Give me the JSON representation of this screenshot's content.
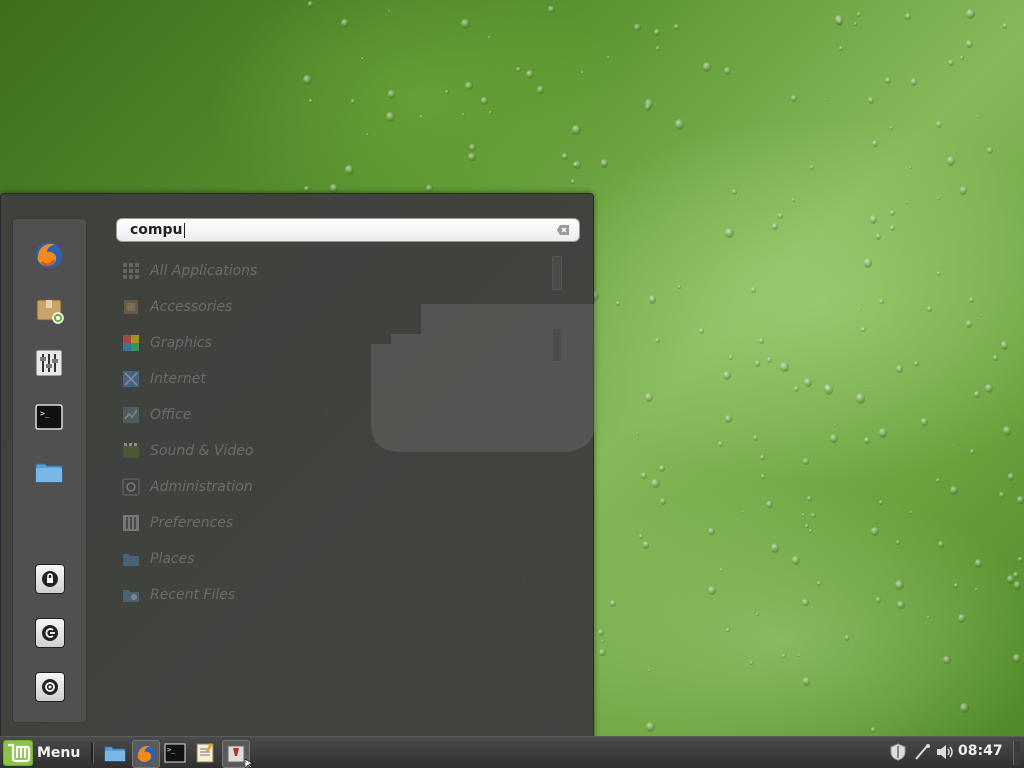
{
  "search": {
    "value": "compu"
  },
  "categories": [
    {
      "label": "All Applications",
      "icon": "all-apps-icon"
    },
    {
      "label": "Accessories",
      "icon": "accessories-icon"
    },
    {
      "label": "Graphics",
      "icon": "graphics-icon"
    },
    {
      "label": "Internet",
      "icon": "internet-icon"
    },
    {
      "label": "Office",
      "icon": "office-icon"
    },
    {
      "label": "Sound & Video",
      "icon": "sound-video-icon"
    },
    {
      "label": "Administration",
      "icon": "administration-icon"
    },
    {
      "label": "Preferences",
      "icon": "preferences-icon"
    },
    {
      "label": "Places",
      "icon": "places-icon"
    },
    {
      "label": "Recent Files",
      "icon": "recent-files-icon"
    }
  ],
  "favorites": [
    "firefox-icon",
    "software-manager-icon",
    "system-settings-icon",
    "terminal-icon",
    "files-folder-icon"
  ],
  "session_buttons": [
    "lock-screen-icon",
    "logout-icon",
    "shutdown-icon"
  ],
  "taskbar": {
    "menu_label": "Menu",
    "launchers": [
      "files-folder-icon",
      "firefox-icon",
      "terminal-icon",
      "text-editor-icon",
      "app-window-icon"
    ],
    "tray": [
      "update-shield-icon",
      "network-icon",
      "volume-icon"
    ],
    "clock": "08:47"
  },
  "colors": {
    "menu_bg": "#3e3e3e",
    "favorites_bg": "#505050",
    "taskbar_bg": "#3a3a3a",
    "mint_green": "#8bc34a"
  }
}
